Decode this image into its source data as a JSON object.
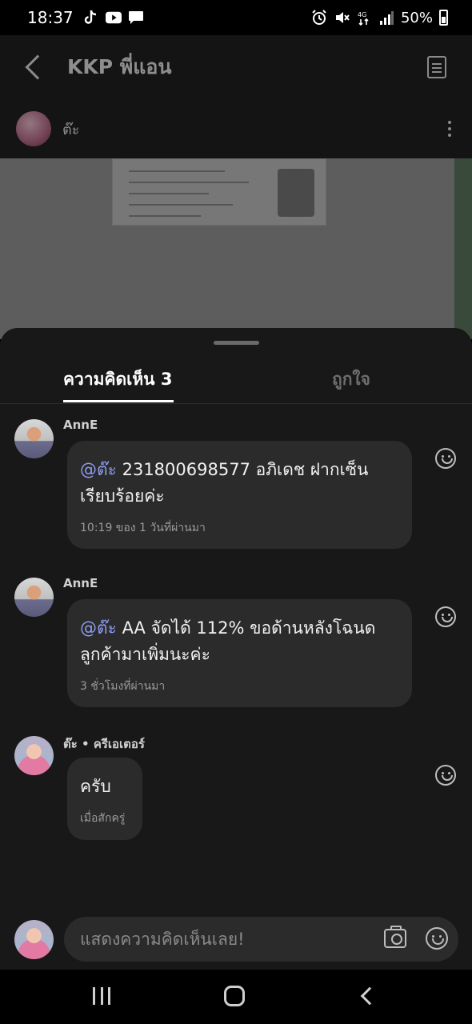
{
  "status_bar": {
    "time": "18:37",
    "battery": "50%",
    "network": "4G",
    "left_icons": [
      "tiktok-icon",
      "youtube-icon",
      "message-icon"
    ],
    "right_icons": [
      "alarm-icon",
      "mute-icon",
      "network-4g-icon",
      "signal-icon",
      "battery-icon"
    ]
  },
  "app_bar": {
    "title": "KKP พี่แอน",
    "icons": [
      "back-icon",
      "document-icon"
    ]
  },
  "post": {
    "author": "ต๊ะ"
  },
  "sheet": {
    "tabs": [
      {
        "label": "ความคิดเห็น 3",
        "active": true
      },
      {
        "label": "ถูกใจ",
        "active": false
      }
    ],
    "comments": [
      {
        "name": "AnnE",
        "mention": "@ต๊ะ",
        "text": " 231800698577 อภิเดช ฝากเซ็นเรียบร้อยค่ะ",
        "time": "10:19 ของ 1 วันที่ผ่านมา"
      },
      {
        "name": "AnnE",
        "mention": "@ต๊ะ",
        "text": " AA จัดได้ 112%  ขอด้านหลังโฉนดลูกค้ามาเพิ่มนะค่ะ",
        "time": "3 ชั่วโมงที่ผ่านมา"
      },
      {
        "name": "ต๊ะ • ครีเอเตอร์",
        "mention": "",
        "text": "ครับ",
        "time": "เมื่อสักครู่"
      }
    ]
  },
  "input": {
    "placeholder": "แสดงความคิดเห็นเลย!",
    "icons": [
      "camera-icon",
      "emoji-icon"
    ]
  },
  "nav_bar": {
    "icons": [
      "recent-apps-icon",
      "home-icon",
      "back-icon"
    ]
  },
  "colors": {
    "mention": "#8d9cf2",
    "sheet_bg": "#181818",
    "bubble_bg": "#2b2b2b"
  }
}
